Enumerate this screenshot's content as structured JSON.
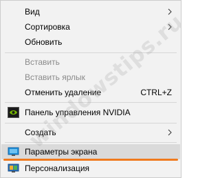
{
  "menu": {
    "items": [
      {
        "label": "Вид"
      },
      {
        "label": "Сортировка"
      },
      {
        "label": "Обновить"
      },
      {
        "label": "Вставить"
      },
      {
        "label": "Вставить ярлык"
      },
      {
        "label": "Отменить удаление",
        "shortcut": "CTRL+Z"
      },
      {
        "label": "Панель управления NVIDIA",
        "icon": "nvidia-icon"
      },
      {
        "label": "Создать"
      },
      {
        "label": "Параметры экрана",
        "icon": "display-settings-icon"
      },
      {
        "label": "Персонализация",
        "icon": "personalization-icon"
      }
    ]
  },
  "watermark": "windowstips.ru",
  "colors": {
    "menu_bg": "#f2f2f2",
    "highlight": "#dadada",
    "disabled_text": "#8a8a8a",
    "underline_mark": "#f07a1e",
    "nvidia_green": "#76b900",
    "display_blue": "#1e90d8"
  }
}
